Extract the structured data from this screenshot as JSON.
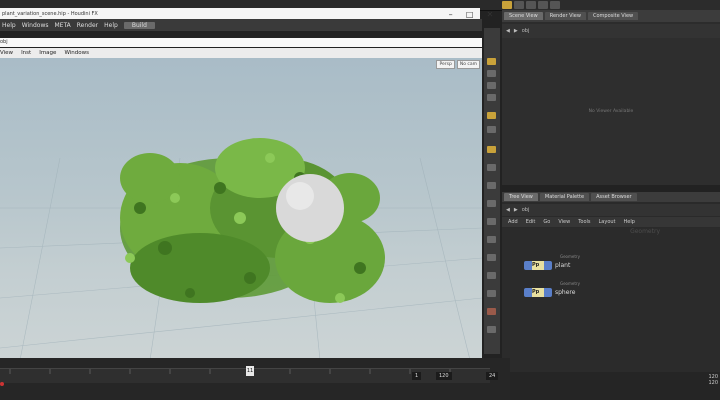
{
  "app": {
    "menubar": [
      "Help",
      "Windows",
      "META",
      "Render",
      "Help"
    ],
    "shelf_chip": "Build",
    "window_title": "plant_variation_scene.hip - Houdini FX",
    "vp_menu": [
      "View",
      "Inst",
      "Image",
      "Windows"
    ],
    "vp_url": "obj",
    "vp_badges": [
      "Persp",
      "No cam"
    ]
  },
  "right_top": {
    "tabs": [
      "Scene View",
      "Render View",
      "Composite View"
    ],
    "path": "obj",
    "empty_message": "No Viewer Available"
  },
  "right_bottom": {
    "tabs": [
      "Tree View",
      "Material Palette",
      "Asset Browser"
    ],
    "path": "obj",
    "menu": [
      "Add",
      "Edit",
      "Go",
      "View",
      "Tools",
      "Layout",
      "Help"
    ],
    "watermark": "Geometry",
    "nodes": [
      {
        "name": "plant",
        "type": "Geometry",
        "label": "Pp"
      },
      {
        "name": "sphere",
        "type": "Geometry",
        "label": "Pp"
      }
    ]
  },
  "timeline": {
    "frame": "11",
    "start": "1",
    "end": "120",
    "step": "24",
    "clock_time": "120",
    "clock_date": "120"
  },
  "colors": {
    "viewport_top": "#a9bcc7",
    "viewport_bottom": "#ccd4d5",
    "plant_green": "#4f8a2a",
    "sphere": "#d8d8d8",
    "node_blue": "#5a7fc9"
  }
}
